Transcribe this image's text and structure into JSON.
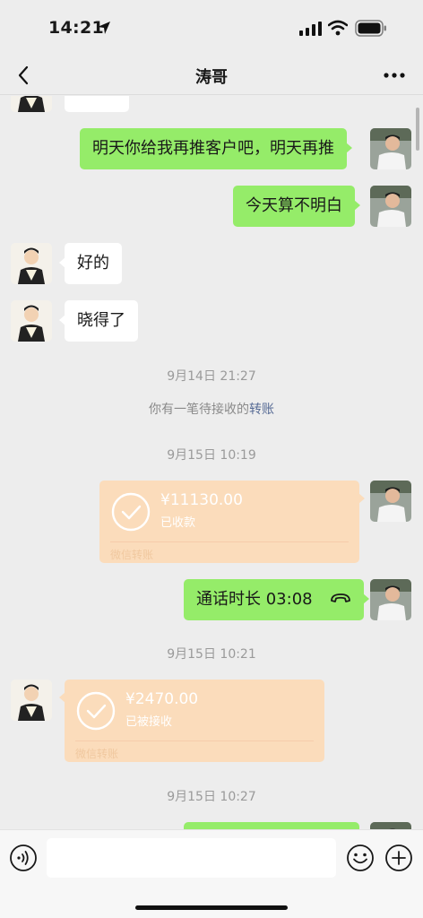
{
  "status_bar": {
    "time": "14:21"
  },
  "nav": {
    "title": "涛哥"
  },
  "messages": {
    "m1": "明天你给我再推客户吧，明天再推",
    "m2": "今天算不明白",
    "m3": "好的",
    "m4": "晓得了",
    "ts1": "9月14日 21:27",
    "system_note": {
      "prefix": "你有一笔待接收的",
      "link": "转账"
    },
    "ts2": "9月15日 10:19",
    "transfer1": {
      "amount": "¥11130.00",
      "status": "已收款",
      "footer": "微信转账"
    },
    "call": {
      "label": "通话时长 03:08"
    },
    "ts3": "9月15日 10:21",
    "transfer2": {
      "amount": "¥2470.00",
      "status": "已被接收",
      "footer": "微信转账"
    },
    "ts4": "9月15日 10:27"
  },
  "colors": {
    "green_bubble": "#95ec69",
    "transfer_bg": "#fbdcbb",
    "link": "#576b95"
  },
  "icons": {
    "back": "chevron-left-icon",
    "more": "ellipsis-icon",
    "voice": "voice-icon",
    "emoji": "emoji-icon",
    "plus": "plus-icon",
    "check": "check-circle-icon",
    "call": "phone-hangup-icon"
  }
}
